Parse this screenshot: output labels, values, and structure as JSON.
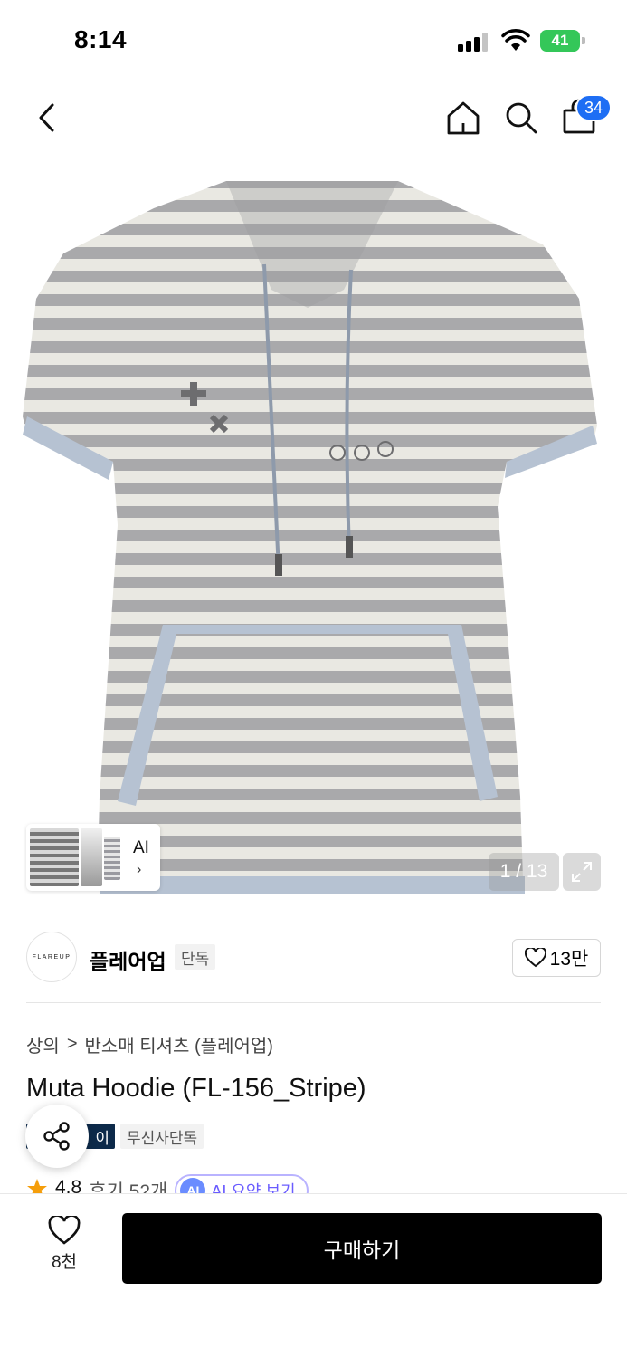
{
  "status_bar": {
    "time": "8:14",
    "battery": "41"
  },
  "nav": {
    "cart_count": "34"
  },
  "gallery": {
    "thumb_label": "AI",
    "counter": "1 / 13"
  },
  "brand": {
    "logo_text": "FLAREUP",
    "name": "플레어업",
    "tag": "단독",
    "likes": "13만"
  },
  "breadcrumb": {
    "category": "상의",
    "separator": ">",
    "subcategory": "반소매 티셔츠 (플레어업)"
  },
  "product": {
    "title": "Muta Hoodie (FL-156_Stripe)"
  },
  "badges": {
    "dark": "이",
    "light": "무신사단독"
  },
  "rating": {
    "score": "4.8",
    "reviews": "후기 52개",
    "ai_icon": "AI",
    "ai_label": "AI 요약 보기",
    "star_color": "#f59e0b"
  },
  "bottom": {
    "wish_count": "8천",
    "buy_label": "구매하기"
  },
  "icons": [
    "back-icon",
    "home-icon",
    "search-icon",
    "cart-icon",
    "expand-icon",
    "heart-icon",
    "share-icon",
    "star-icon"
  ]
}
